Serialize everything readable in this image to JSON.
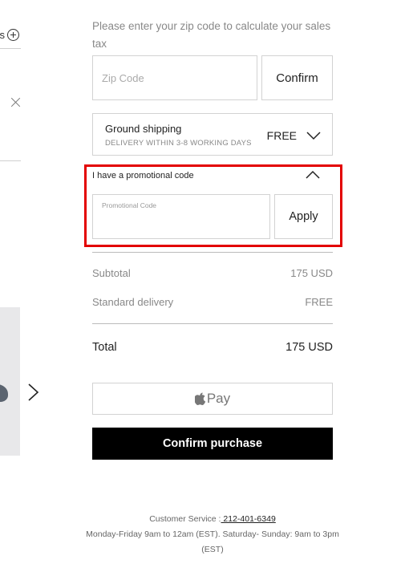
{
  "left_panel": {
    "fragment_text": "s",
    "product_alt": ""
  },
  "zip": {
    "prompt": "Please enter your zip code to calculate your sales tax",
    "placeholder": "Zip Code",
    "confirm_label": "Confirm"
  },
  "shipping": {
    "title": "Ground shipping",
    "subtitle": "DELIVERY WITHIN 3-8 WORKING DAYS",
    "price": "FREE"
  },
  "promo": {
    "label": "I have a promotional code",
    "field_label": "Promotional Code",
    "field_value": "",
    "apply_label": "Apply",
    "expanded": true,
    "highlight_color": "#e30000"
  },
  "summary": {
    "subtotal_label": "Subtotal",
    "subtotal_value": "175 USD",
    "delivery_label": "Standard delivery",
    "delivery_value": "FREE",
    "total_label": "Total",
    "total_value": "175 USD"
  },
  "payment": {
    "apple_pay_label": "Pay",
    "confirm_purchase_label": "Confirm purchase"
  },
  "customer_service": {
    "label": "Customer Service :",
    "phone": " 212-401-6349",
    "hours": "Monday-Friday 9am to 12am (EST). Saturday- Sunday: 9am to 3pm (EST)"
  },
  "colors": {
    "primary_button_bg": "#000000",
    "border": "#d2d2d2",
    "muted_text": "#888888"
  }
}
